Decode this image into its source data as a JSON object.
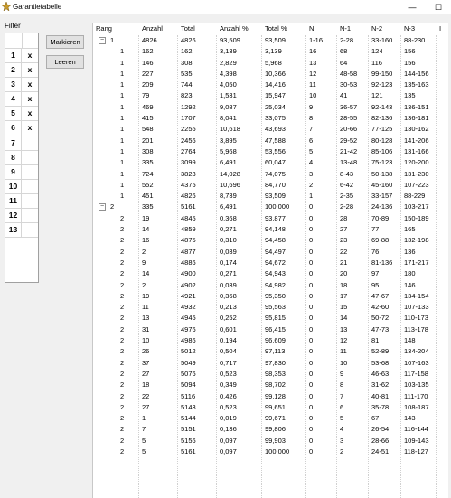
{
  "window": {
    "title": "Garantietabelle",
    "minimize_glyph": "—",
    "maximize_glyph": "☐"
  },
  "filter": {
    "label": "Filter",
    "rows": [
      {
        "num": "1",
        "mark": "x"
      },
      {
        "num": "2",
        "mark": "x"
      },
      {
        "num": "3",
        "mark": "x"
      },
      {
        "num": "4",
        "mark": "x"
      },
      {
        "num": "5",
        "mark": "x"
      },
      {
        "num": "6",
        "mark": "x"
      },
      {
        "num": "7",
        "mark": ""
      },
      {
        "num": "8",
        "mark": ""
      },
      {
        "num": "9",
        "mark": ""
      },
      {
        "num": "10",
        "mark": ""
      },
      {
        "num": "11",
        "mark": ""
      },
      {
        "num": "12",
        "mark": ""
      },
      {
        "num": "13",
        "mark": ""
      }
    ]
  },
  "buttons": {
    "markieren": "Markieren",
    "leeren": "Leeren"
  },
  "table": {
    "headers": [
      "Rang",
      "Anzahl",
      "Total",
      "Anzahl %",
      "Total %",
      "N",
      "N-1",
      "N-2",
      "N-3",
      "I"
    ],
    "groups": [
      {
        "toggle": "−",
        "summary": [
          "1",
          "4826",
          "4826",
          "93,509",
          "93,509",
          "1-16",
          "2-28",
          "33-160",
          "88-230"
        ],
        "rows": [
          [
            "1",
            "162",
            "162",
            "3,139",
            "3,139",
            "16",
            "68",
            "124",
            "156"
          ],
          [
            "1",
            "146",
            "308",
            "2,829",
            "5,968",
            "13",
            "64",
            "116",
            "156"
          ],
          [
            "1",
            "227",
            "535",
            "4,398",
            "10,366",
            "12",
            "48-58",
            "99-150",
            "144-156"
          ],
          [
            "1",
            "209",
            "744",
            "4,050",
            "14,416",
            "11",
            "30-53",
            "92-123",
            "135-163"
          ],
          [
            "1",
            "79",
            "823",
            "1,531",
            "15,947",
            "10",
            "41",
            "121",
            "135"
          ],
          [
            "1",
            "469",
            "1292",
            "9,087",
            "25,034",
            "9",
            "36-57",
            "92-143",
            "136-151"
          ],
          [
            "1",
            "415",
            "1707",
            "8,041",
            "33,075",
            "8",
            "28-55",
            "82-136",
            "136-181"
          ],
          [
            "1",
            "548",
            "2255",
            "10,618",
            "43,693",
            "7",
            "20-66",
            "77-125",
            "130-162"
          ],
          [
            "1",
            "201",
            "2456",
            "3,895",
            "47,588",
            "6",
            "29-52",
            "80-128",
            "141-206"
          ],
          [
            "1",
            "308",
            "2764",
            "5,968",
            "53,556",
            "5",
            "21-42",
            "85-106",
            "131-166"
          ],
          [
            "1",
            "335",
            "3099",
            "6,491",
            "60,047",
            "4",
            "13-48",
            "75-123",
            "120-200"
          ],
          [
            "1",
            "724",
            "3823",
            "14,028",
            "74,075",
            "3",
            "8-43",
            "50-138",
            "131-230"
          ],
          [
            "1",
            "552",
            "4375",
            "10,696",
            "84,770",
            "2",
            "6-42",
            "45-160",
            "107-223"
          ],
          [
            "1",
            "451",
            "4826",
            "8,739",
            "93,509",
            "1",
            "2-35",
            "33-157",
            "88-229"
          ]
        ]
      },
      {
        "toggle": "−",
        "summary": [
          "2",
          "335",
          "5161",
          "6,491",
          "100,000",
          "0",
          "2-28",
          "24-136",
          "103-217"
        ],
        "rows": [
          [
            "2",
            "19",
            "4845",
            "0,368",
            "93,877",
            "0",
            "28",
            "70-89",
            "150-189"
          ],
          [
            "2",
            "14",
            "4859",
            "0,271",
            "94,148",
            "0",
            "27",
            "77",
            "165"
          ],
          [
            "2",
            "16",
            "4875",
            "0,310",
            "94,458",
            "0",
            "23",
            "69-88",
            "132-198"
          ],
          [
            "2",
            "2",
            "4877",
            "0,039",
            "94,497",
            "0",
            "22",
            "76",
            "136"
          ],
          [
            "2",
            "9",
            "4886",
            "0,174",
            "94,672",
            "0",
            "21",
            "81-136",
            "171-217"
          ],
          [
            "2",
            "14",
            "4900",
            "0,271",
            "94,943",
            "0",
            "20",
            "97",
            "180"
          ],
          [
            "2",
            "2",
            "4902",
            "0,039",
            "94,982",
            "0",
            "18",
            "95",
            "146"
          ],
          [
            "2",
            "19",
            "4921",
            "0,368",
            "95,350",
            "0",
            "17",
            "47-67",
            "134-154"
          ],
          [
            "2",
            "11",
            "4932",
            "0,213",
            "95,563",
            "0",
            "15",
            "42-60",
            "107-133"
          ],
          [
            "2",
            "13",
            "4945",
            "0,252",
            "95,815",
            "0",
            "14",
            "50-72",
            "110-173"
          ],
          [
            "2",
            "31",
            "4976",
            "0,601",
            "96,415",
            "0",
            "13",
            "47-73",
            "113-178"
          ],
          [
            "2",
            "10",
            "4986",
            "0,194",
            "96,609",
            "0",
            "12",
            "81",
            "148"
          ],
          [
            "2",
            "26",
            "5012",
            "0,504",
            "97,113",
            "0",
            "11",
            "52-89",
            "134-204"
          ],
          [
            "2",
            "37",
            "5049",
            "0,717",
            "97,830",
            "0",
            "10",
            "53-68",
            "107-163"
          ],
          [
            "2",
            "27",
            "5076",
            "0,523",
            "98,353",
            "0",
            "9",
            "46-63",
            "117-158"
          ],
          [
            "2",
            "18",
            "5094",
            "0,349",
            "98,702",
            "0",
            "8",
            "31-62",
            "103-135"
          ],
          [
            "2",
            "22",
            "5116",
            "0,426",
            "99,128",
            "0",
            "7",
            "40-81",
            "111-170"
          ],
          [
            "2",
            "27",
            "5143",
            "0,523",
            "99,651",
            "0",
            "6",
            "35-78",
            "108-187"
          ],
          [
            "2",
            "1",
            "5144",
            "0,019",
            "99,671",
            "0",
            "5",
            "67",
            "143"
          ],
          [
            "2",
            "7",
            "5151",
            "0,136",
            "99,806",
            "0",
            "4",
            "26-54",
            "116-144"
          ],
          [
            "2",
            "5",
            "5156",
            "0,097",
            "99,903",
            "0",
            "3",
            "28-66",
            "109-143"
          ],
          [
            "2",
            "5",
            "5161",
            "0,097",
            "100,000",
            "0",
            "2",
            "24-51",
            "118-127"
          ]
        ]
      }
    ]
  }
}
